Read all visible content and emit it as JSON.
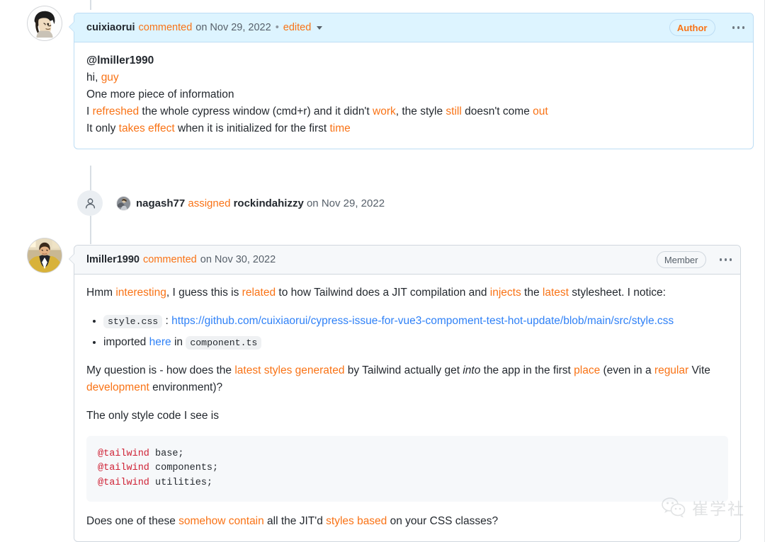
{
  "timeline": {
    "comments": [
      {
        "id": "comment-cuixiaorui",
        "author": "cuixiaorui",
        "verb": "commented",
        "when": "on Nov 29, 2022",
        "separator": "•",
        "edited_label": "edited",
        "badge": "Author",
        "menu_label": "Show options",
        "body_lines": [
          "@lmiller1990",
          "hi, guy",
          "One more piece of information",
          "I refreshed the whole cypress window (cmd+r) and it didn't work, the style still doesn't come out",
          "It only takes effect when it is initialized for the first time"
        ],
        "line1_mention": "@lmiller1990",
        "line2_plain": "hi, ",
        "line2_hl": "guy",
        "line3": "One more piece of information",
        "line4_a": "I ",
        "line4_hl1": "refreshed",
        "line4_b": " the whole cypress window (cmd+r) and it didn't ",
        "line4_hl2": "work",
        "line4_c": ", the style ",
        "line4_hl3": "still",
        "line4_d": " doesn't come ",
        "line4_hl4": "out",
        "line5_a": "It only ",
        "line5_hl1": "takes effect",
        "line5_b": " when it is initialized for the first ",
        "line5_hl2": "time"
      },
      {
        "id": "comment-lmiller1990",
        "author": "lmiller1990",
        "verb": "commented",
        "when": "on Nov 30, 2022",
        "badge": "Member",
        "menu_label": "Show options",
        "p1_a": "Hmm ",
        "p1_hl1": "interesting",
        "p1_b": ", I guess this is ",
        "p1_hl2": "related",
        "p1_c": " to how Tailwind does a JIT compilation and ",
        "p1_hl3": "injects",
        "p1_d": " the ",
        "p1_hl4": "latest",
        "p1_e": " stylesheet. I notice:",
        "bullet1_code": "style.css",
        "bullet1_sep": " : ",
        "bullet1_url": "https://github.com/cuixiaorui/cypress-issue-for-vue3-compoment-test-hot-update/blob/main/src/style.css",
        "bullet2_a": "imported ",
        "bullet2_link": "here",
        "bullet2_b": " in ",
        "bullet2_code": "component.ts",
        "p2_a": "My question is - how does the ",
        "p2_hl1": "latest styles generated",
        "p2_b": " by Tailwind actually get ",
        "p2_em": "into",
        "p2_c": " the app in the first ",
        "p2_hl2": "place",
        "p2_d": " (even in a ",
        "p2_hl3": "regular",
        "p2_e": " Vite ",
        "p2_hl4": "development",
        "p2_f": " environment)?",
        "p3": "The only style code I see is",
        "code_block": {
          "lines": [
            {
              "at": "@tailwind",
              "rest": " base;"
            },
            {
              "at": "@tailwind",
              "rest": " components;"
            },
            {
              "at": "@tailwind",
              "rest": " utilities;"
            }
          ]
        },
        "p4_a": "Does one of these ",
        "p4_hl1": "somehow contain",
        "p4_b": " all the JIT'd ",
        "p4_hl2": "styles based",
        "p4_c": " on your CSS classes?"
      }
    ],
    "events": [
      {
        "id": "event-assigned",
        "icon": "person-icon",
        "actor": "nagash77",
        "verb": "assigned",
        "target": "rockindahizzy",
        "when": "on Nov 29, 2022"
      }
    ]
  },
  "watermark": {
    "icon": "wechat-icon",
    "text": "崔学社"
  },
  "colors": {
    "highlight": "#f97316",
    "link": "#2f81f7",
    "author_badge_text": "#f97316",
    "author_badge_border": "#bdddf4",
    "member_badge_text": "#57606a",
    "header_blue_bg": "#ddf4ff",
    "header_gray_bg": "#f6f8fa",
    "border": "#d0d7de",
    "code_at": "#cf2235",
    "text": "#24292f",
    "muted": "#57606a"
  }
}
